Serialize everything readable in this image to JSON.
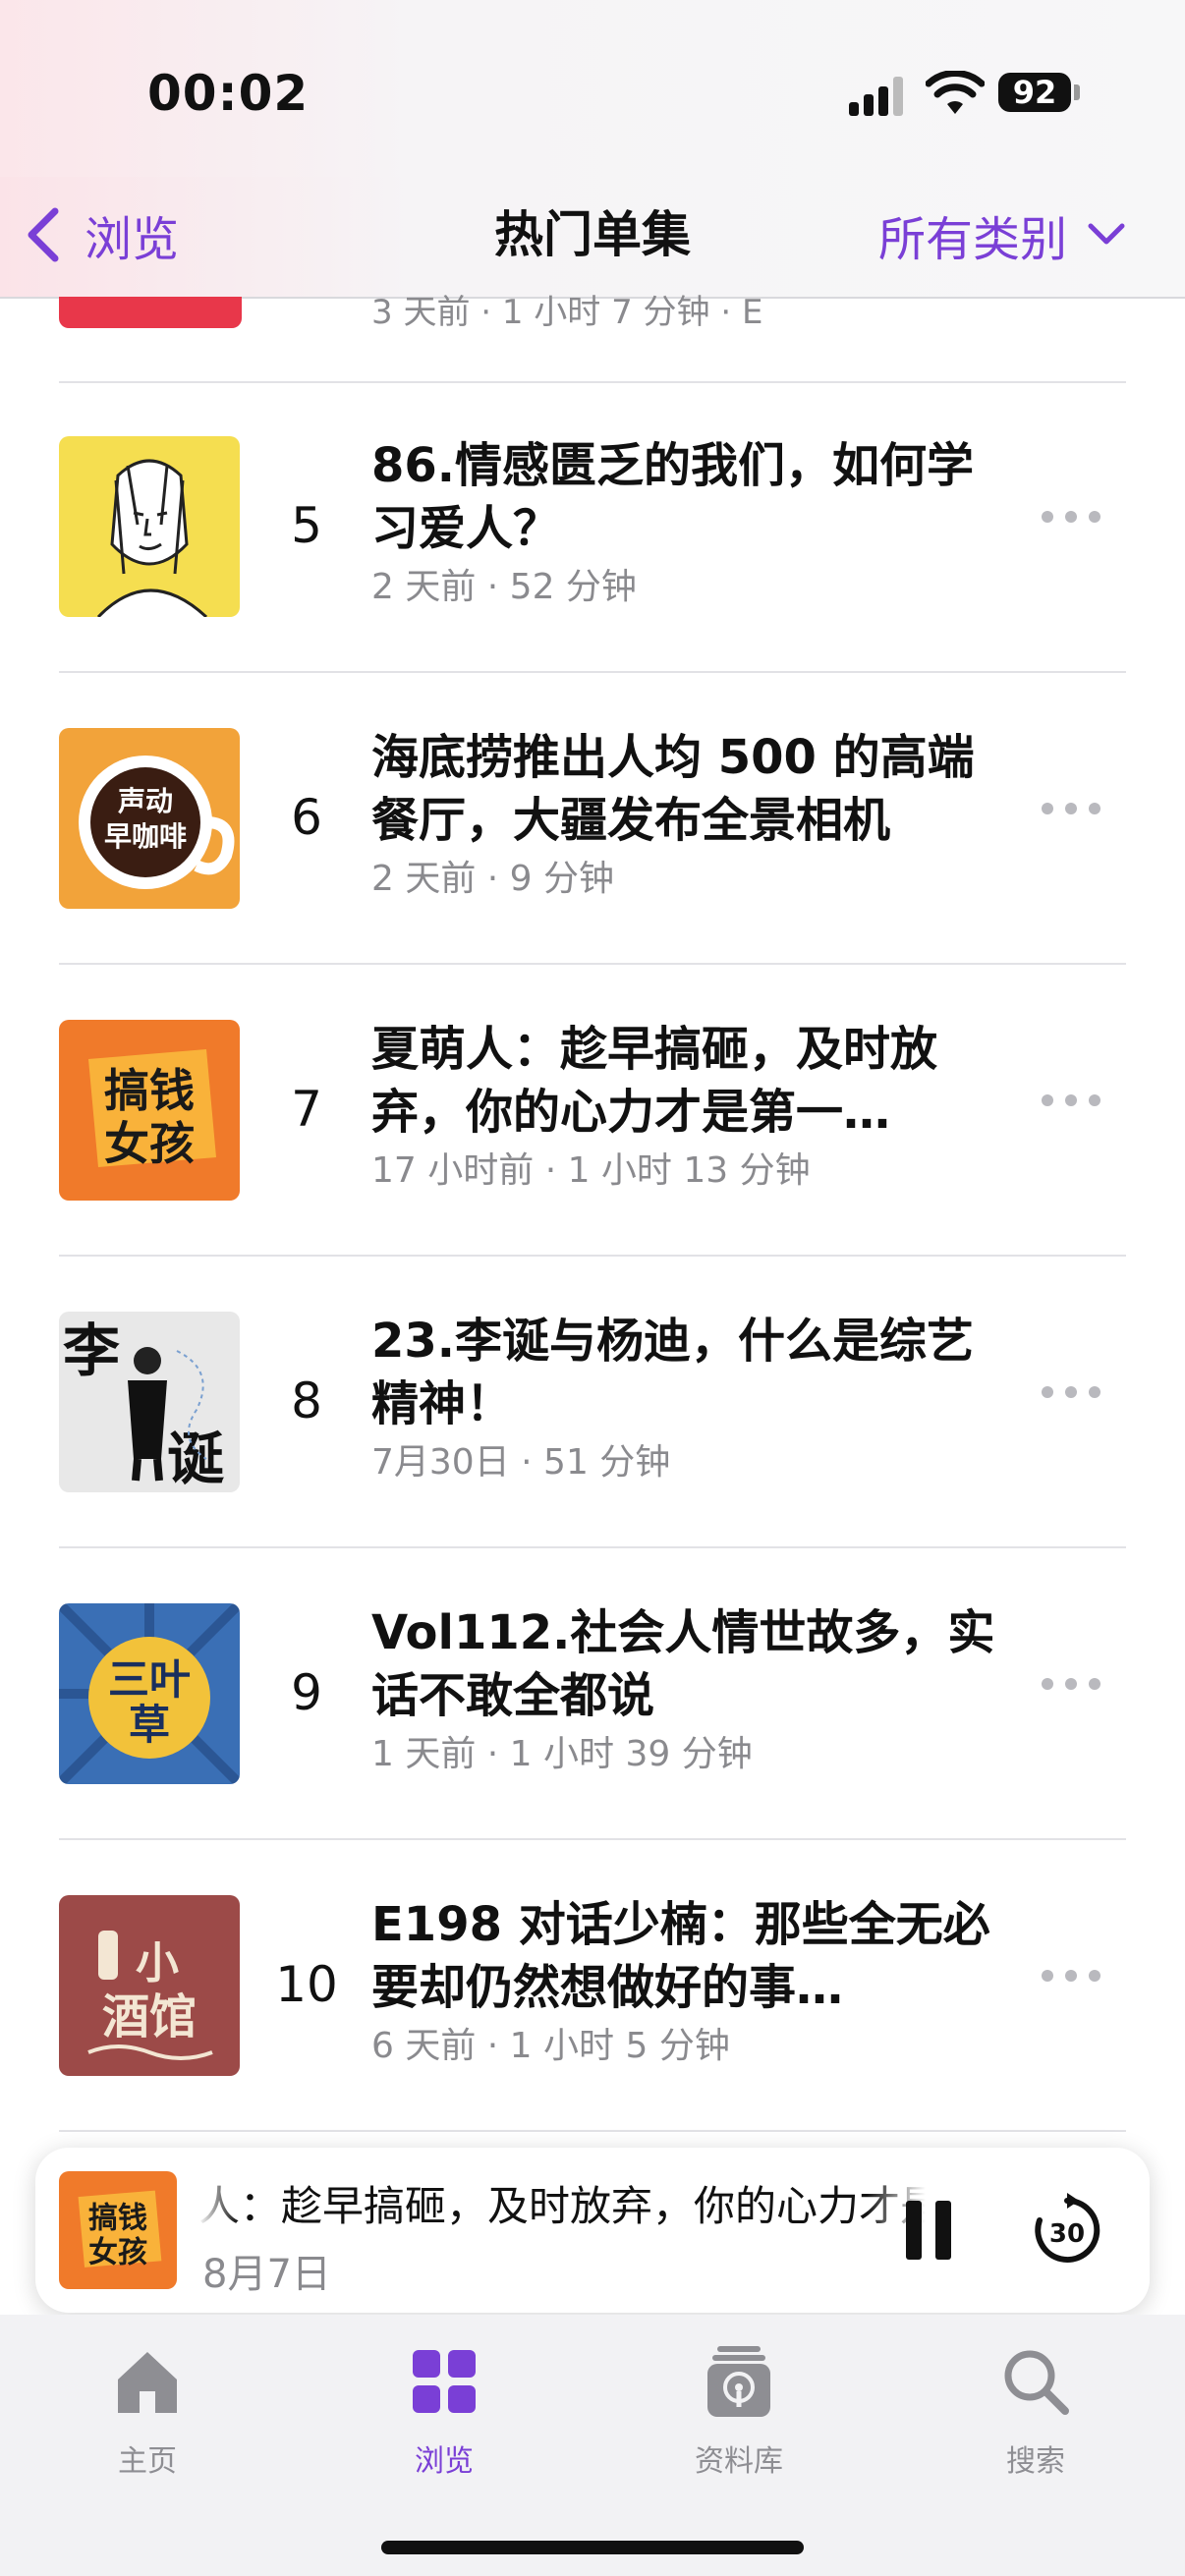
{
  "status": {
    "time": "00:02",
    "battery": "92"
  },
  "nav": {
    "back_label": "浏览",
    "title": "热门单集",
    "category_label": "所有类别"
  },
  "partial_item": {
    "meta": "3 天前 · 1 小时 7 分钟 · E"
  },
  "episodes": [
    {
      "rank": "5",
      "title": "86.情感匮乏的我们，如何学习爱人？",
      "meta": "2 天前 · 52 分钟",
      "thumb_color": "#f5de50"
    },
    {
      "rank": "6",
      "title": "海底捞推出人均 500 的高端餐厅，大疆发布全景相机",
      "meta": "2 天前 · 9 分钟",
      "thumb_color": "#f2a33a",
      "thumb_text": "声动早咖啡"
    },
    {
      "rank": "7",
      "title": "夏萌人：趁早搞砸，及时放弃，你的心力才是第一…",
      "meta": "17 小时前 · 1 小时 13 分钟",
      "thumb_color": "#f07a2a",
      "thumb_text": "搞钱女孩"
    },
    {
      "rank": "8",
      "title": "23.李诞与杨迪，什么是综艺精神！",
      "meta": "7月30日 · 51 分钟",
      "thumb_color": "#e8e8e8",
      "thumb_text": "李诞"
    },
    {
      "rank": "9",
      "title": "Vol112.社会人情世故多，实话不敢全都说",
      "meta": "1 天前 · 1 小时 39 分钟",
      "thumb_color": "#3a6fb5",
      "thumb_text": "三叶草"
    },
    {
      "rank": "10",
      "title": "E198 对话少楠：那些全无必要却仍然想做好的事…",
      "meta": "6 天前 · 1 小时 5 分钟",
      "thumb_color": "#9c4a48",
      "thumb_text": "小酒馆"
    }
  ],
  "now_playing": {
    "title": "人：趁早搞砸，及时放弃，你的心力才是第一",
    "date": "8月7日",
    "thumb_text": "搞钱女孩",
    "skip_seconds": "30"
  },
  "tabs": [
    {
      "label": "主页",
      "icon": "home-icon"
    },
    {
      "label": "浏览",
      "icon": "grid-icon",
      "active": true
    },
    {
      "label": "资料库",
      "icon": "library-icon"
    },
    {
      "label": "搜索",
      "icon": "search-icon"
    }
  ],
  "colors": {
    "accent": "#7a3fd6",
    "secondary_text": "#8a8a8e"
  }
}
